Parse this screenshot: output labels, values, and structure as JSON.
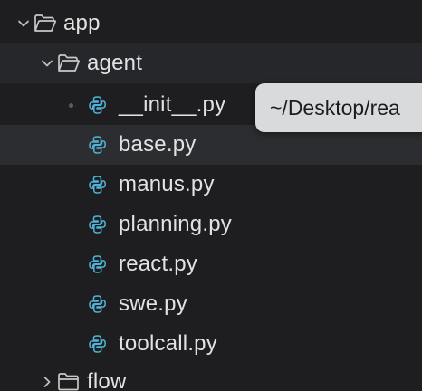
{
  "tree": {
    "root_folder": {
      "label": "app",
      "expanded": true
    },
    "sub_folder": {
      "label": "agent",
      "expanded": true
    },
    "files": [
      {
        "label": "__init__.py"
      },
      {
        "label": "base.py"
      },
      {
        "label": "manus.py"
      },
      {
        "label": "planning.py"
      },
      {
        "label": "react.py"
      },
      {
        "label": "swe.py"
      },
      {
        "label": "toolcall.py"
      }
    ],
    "collapsed_folder": {
      "label": "flow",
      "expanded": false
    }
  },
  "tooltip": {
    "text": "~/Desktop/rea"
  },
  "colors": {
    "background": "#1e1e20",
    "python_icon": "#4fb3d9",
    "folder_icon": "#c8c8c8",
    "tooltip_bg": "#d9dadc"
  },
  "icons": {
    "folder": "folder-open-icon",
    "folder_closed": "folder-icon",
    "file": "python-file-icon",
    "expand": "chevron-down-icon",
    "collapse": "chevron-right-icon"
  }
}
